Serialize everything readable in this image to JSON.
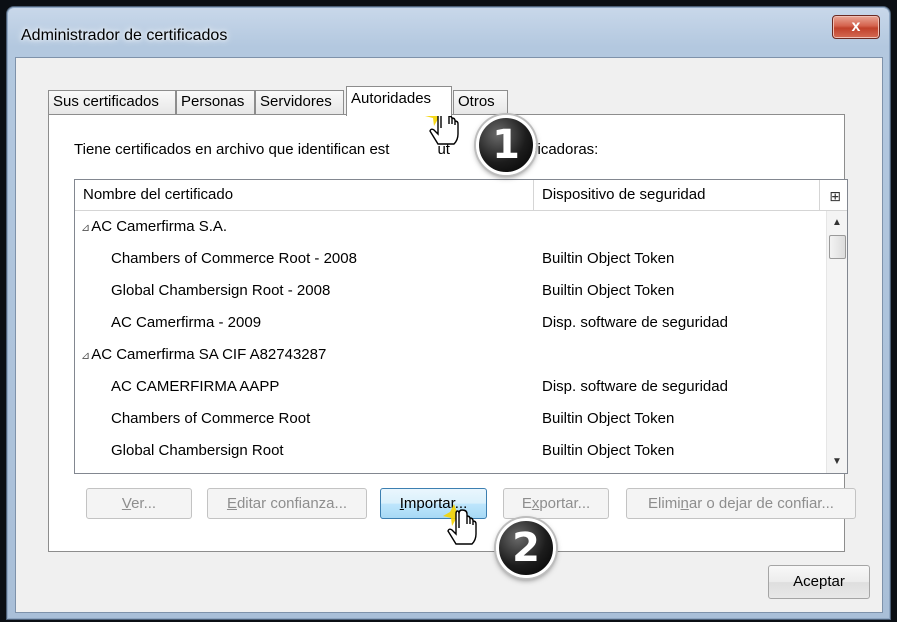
{
  "window": {
    "title": "Administrador de certificados",
    "close_label": "x"
  },
  "tabs": [
    {
      "label": "Sus certificados",
      "active": false
    },
    {
      "label": "Personas",
      "active": false
    },
    {
      "label": "Servidores",
      "active": false
    },
    {
      "label": "Autoridades",
      "active": true
    },
    {
      "label": "Otros",
      "active": false
    }
  ],
  "panel": {
    "description_left": "Tiene certificados en archivo que identifican est",
    "description_mid": "ut",
    "description_right": "certificadoras:"
  },
  "tree": {
    "columns": [
      "Nombre del certificado",
      "Dispositivo de seguridad"
    ],
    "column_picker_icon": "column-picker-icon",
    "rows": [
      {
        "name": "AC Camerfirma S.A.",
        "device": "",
        "group": true,
        "twisty": "⊿"
      },
      {
        "name": "Chambers of Commerce Root - 2008",
        "device": "Builtin Object Token",
        "group": false
      },
      {
        "name": "Global Chambersign Root - 2008",
        "device": "Builtin Object Token",
        "group": false
      },
      {
        "name": "AC Camerfirma - 2009",
        "device": "Disp. software de seguridad",
        "group": false
      },
      {
        "name": "AC Camerfirma SA CIF A82743287",
        "device": "",
        "group": true,
        "twisty": "⊿"
      },
      {
        "name": "AC CAMERFIRMA AAPP",
        "device": "Disp. software de seguridad",
        "group": false
      },
      {
        "name": "Chambers of Commerce Root",
        "device": "Builtin Object Token",
        "group": false
      },
      {
        "name": "Global Chambersign Root",
        "device": "Builtin Object Token",
        "group": false
      }
    ]
  },
  "buttons": {
    "ver": {
      "u": "V",
      "rest": "er..."
    },
    "editar": {
      "u": "E",
      "rest": "ditar confianza..."
    },
    "importar": {
      "u": "I",
      "rest": "mportar..."
    },
    "exportar_pre": "E",
    "exportar_u": "x",
    "exportar_post": "portar...",
    "eliminar_pre": "Elimi",
    "eliminar_u": "n",
    "eliminar_post": "ar o dejar de confiar...",
    "aceptar": "Aceptar"
  },
  "annotations": {
    "step1": "1",
    "step2": "2"
  },
  "colors": {
    "accent": "#3c7fb1",
    "close": "#c0412b",
    "highlight": "#f5d400"
  }
}
